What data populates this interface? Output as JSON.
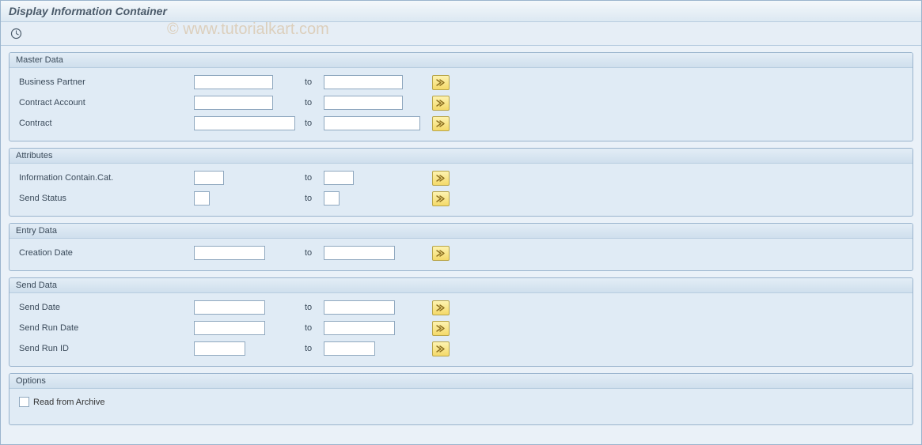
{
  "title": "Display Information Container",
  "watermark": "© www.tutorialkart.com",
  "to_label": "to",
  "groups": {
    "master_data": {
      "title": "Master Data",
      "rows": {
        "business_partner": {
          "label": "Business Partner",
          "from": "",
          "to": ""
        },
        "contract_account": {
          "label": "Contract Account",
          "from": "",
          "to": ""
        },
        "contract": {
          "label": "Contract",
          "from": "",
          "to": ""
        }
      }
    },
    "attributes": {
      "title": "Attributes",
      "rows": {
        "info_contain_cat": {
          "label": "Information Contain.Cat.",
          "from": "",
          "to": ""
        },
        "send_status": {
          "label": "Send Status",
          "from": "",
          "to": ""
        }
      }
    },
    "entry_data": {
      "title": "Entry Data",
      "rows": {
        "creation_date": {
          "label": "Creation Date",
          "from": "",
          "to": ""
        }
      }
    },
    "send_data": {
      "title": "Send Data",
      "rows": {
        "send_date": {
          "label": "Send Date",
          "from": "",
          "to": ""
        },
        "send_run_date": {
          "label": "Send Run Date",
          "from": "",
          "to": ""
        },
        "send_run_id": {
          "label": "Send Run ID",
          "from": "",
          "to": ""
        }
      }
    },
    "options": {
      "title": "Options",
      "read_from_archive": {
        "label": "Read from Archive",
        "checked": false
      }
    }
  }
}
